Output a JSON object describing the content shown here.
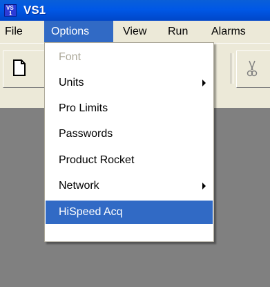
{
  "window": {
    "title": "VS1",
    "icon_lines": [
      "VS",
      "1"
    ]
  },
  "menubar": {
    "items": [
      "File",
      "Options",
      "View",
      "Run",
      "Alarms"
    ],
    "active": "Options"
  },
  "toolbar": {
    "icons": [
      "new-document-icon",
      "cut-icon"
    ]
  },
  "options_menu": {
    "items": [
      {
        "label": "Font",
        "enabled": false,
        "submenu": false
      },
      {
        "label": "Units",
        "enabled": true,
        "submenu": true
      },
      {
        "label": "Pro Limits",
        "enabled": true,
        "submenu": false
      },
      {
        "label": "Passwords",
        "enabled": true,
        "submenu": false
      },
      {
        "label": "Product Rocket",
        "enabled": true,
        "submenu": false
      },
      {
        "label": "Network",
        "enabled": true,
        "submenu": true
      },
      {
        "label": "HiSpeed Acq",
        "enabled": true,
        "submenu": false,
        "highlighted": true
      }
    ]
  },
  "colors": {
    "titlebar": "#0058e6",
    "menu_highlight": "#316ac5",
    "disabled_text": "#aca899",
    "workspace": "#808080"
  }
}
